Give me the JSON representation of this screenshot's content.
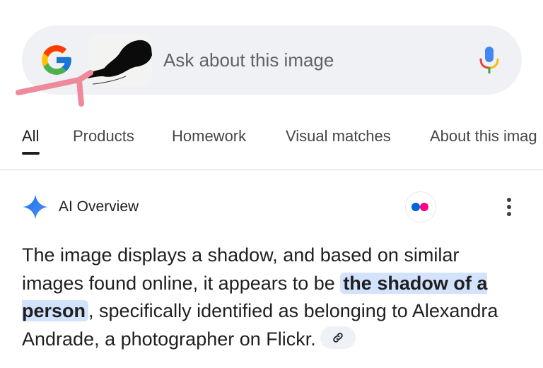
{
  "search": {
    "placeholder": "Ask about this image",
    "logo_icon": "google-g-icon",
    "mic_icon": "microphone-icon"
  },
  "tabs": [
    {
      "label": "All",
      "active": true
    },
    {
      "label": "Products",
      "active": false
    },
    {
      "label": "Homework",
      "active": false
    },
    {
      "label": "Visual matches",
      "active": false
    },
    {
      "label": "About this imag",
      "active": false
    }
  ],
  "ai_overview": {
    "title": "AI Overview",
    "source_icon": "flickr-icon",
    "text_before": "The image displays a shadow, and based on similar images found online, it appears to be ",
    "highlight": "the shadow of a person",
    "text_after": ", specifically identified as belonging to Alexandra Andrade, a photographer on Flickr.",
    "link_icon": "link-icon"
  },
  "colors": {
    "search_bg": "#eff1f5",
    "highlight_bg": "#d3e3fd",
    "annotation": "#ef8a9a",
    "flickr_blue": "#0063dc",
    "flickr_pink": "#ff0084"
  }
}
